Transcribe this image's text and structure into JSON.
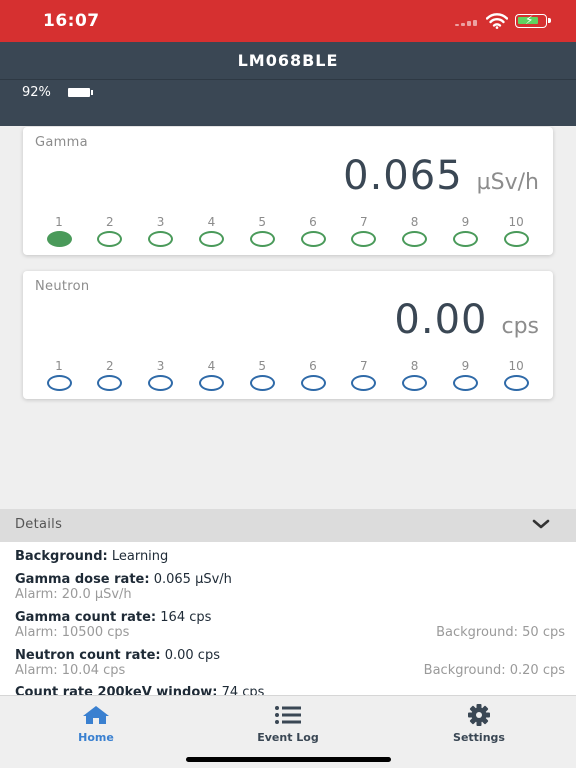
{
  "status_bar": {
    "time": "16:07"
  },
  "header": {
    "title": "LM068BLE"
  },
  "device": {
    "battery_percent": "92%"
  },
  "gamma": {
    "title": "Gamma",
    "value": "0.065",
    "unit": "µSv/h",
    "levels": [
      "1",
      "2",
      "3",
      "4",
      "5",
      "6",
      "7",
      "8",
      "9",
      "10"
    ],
    "active_level": 1,
    "color": "#4a9a5a"
  },
  "neutron": {
    "title": "Neutron",
    "value": "0.00",
    "unit": "cps",
    "levels": [
      "1",
      "2",
      "3",
      "4",
      "5",
      "6",
      "7",
      "8",
      "9",
      "10"
    ],
    "active_level": 0,
    "color": "#2f6aa8"
  },
  "details": {
    "title": "Details",
    "rows": [
      {
        "label": "Background:",
        "value": "Learning",
        "sub_left": "",
        "sub_right": ""
      },
      {
        "label": "Gamma dose rate:",
        "value": "0.065 µSv/h",
        "sub_left": "Alarm: 20.0 µSv/h",
        "sub_right": ""
      },
      {
        "label": "Gamma count rate:",
        "value": "164 cps",
        "sub_left": "Alarm: 10500 cps",
        "sub_right": "Background: 50 cps"
      },
      {
        "label": "Neutron count rate:",
        "value": "0.00 cps",
        "sub_left": "Alarm: 10.04 cps",
        "sub_right": "Background: 0.20 cps"
      },
      {
        "label": "Count rate 200keV window:",
        "value": "74 cps",
        "sub_left": "",
        "sub_right": ""
      }
    ]
  },
  "tabs": [
    {
      "label": "Home",
      "icon": "home-icon",
      "active": true
    },
    {
      "label": "Event Log",
      "icon": "list-icon",
      "active": false
    },
    {
      "label": "Settings",
      "icon": "gear-icon",
      "active": false
    }
  ],
  "colors": {
    "status_bar": "#d63030",
    "header": "#3a4754",
    "accent": "#3a80d0"
  }
}
